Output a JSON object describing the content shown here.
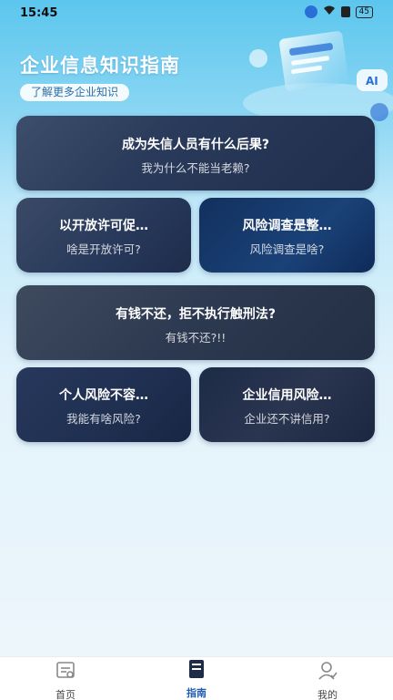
{
  "status_bar": {
    "time": "15:45",
    "battery": "45"
  },
  "header": {
    "title": "企业信息知识指南",
    "subtitle": "了解更多企业知识",
    "hero_art_label": "AI"
  },
  "cards": [
    {
      "title": "成为失信人员有什么后果?",
      "subtitle": "我为什么不能当老赖?"
    },
    {
      "title": "以开放许可促…",
      "subtitle": "啥是开放许可?"
    },
    {
      "title": "风险调查是整…",
      "subtitle": "风险调查是啥?"
    },
    {
      "title": "有钱不还，拒不执行触刑法?",
      "subtitle": "有钱不还?!!"
    },
    {
      "title": "个人风险不容…",
      "subtitle": "我能有啥风险?"
    },
    {
      "title": "企业信用风险…",
      "subtitle": "企业还不讲信用?"
    }
  ],
  "bottom_nav": {
    "home_label": "首页",
    "center_label": "指南",
    "mine_label": "我的"
  },
  "icons": [
    "home-icon",
    "guide-icon",
    "user-icon",
    "wifi-icon",
    "battery-icon"
  ]
}
